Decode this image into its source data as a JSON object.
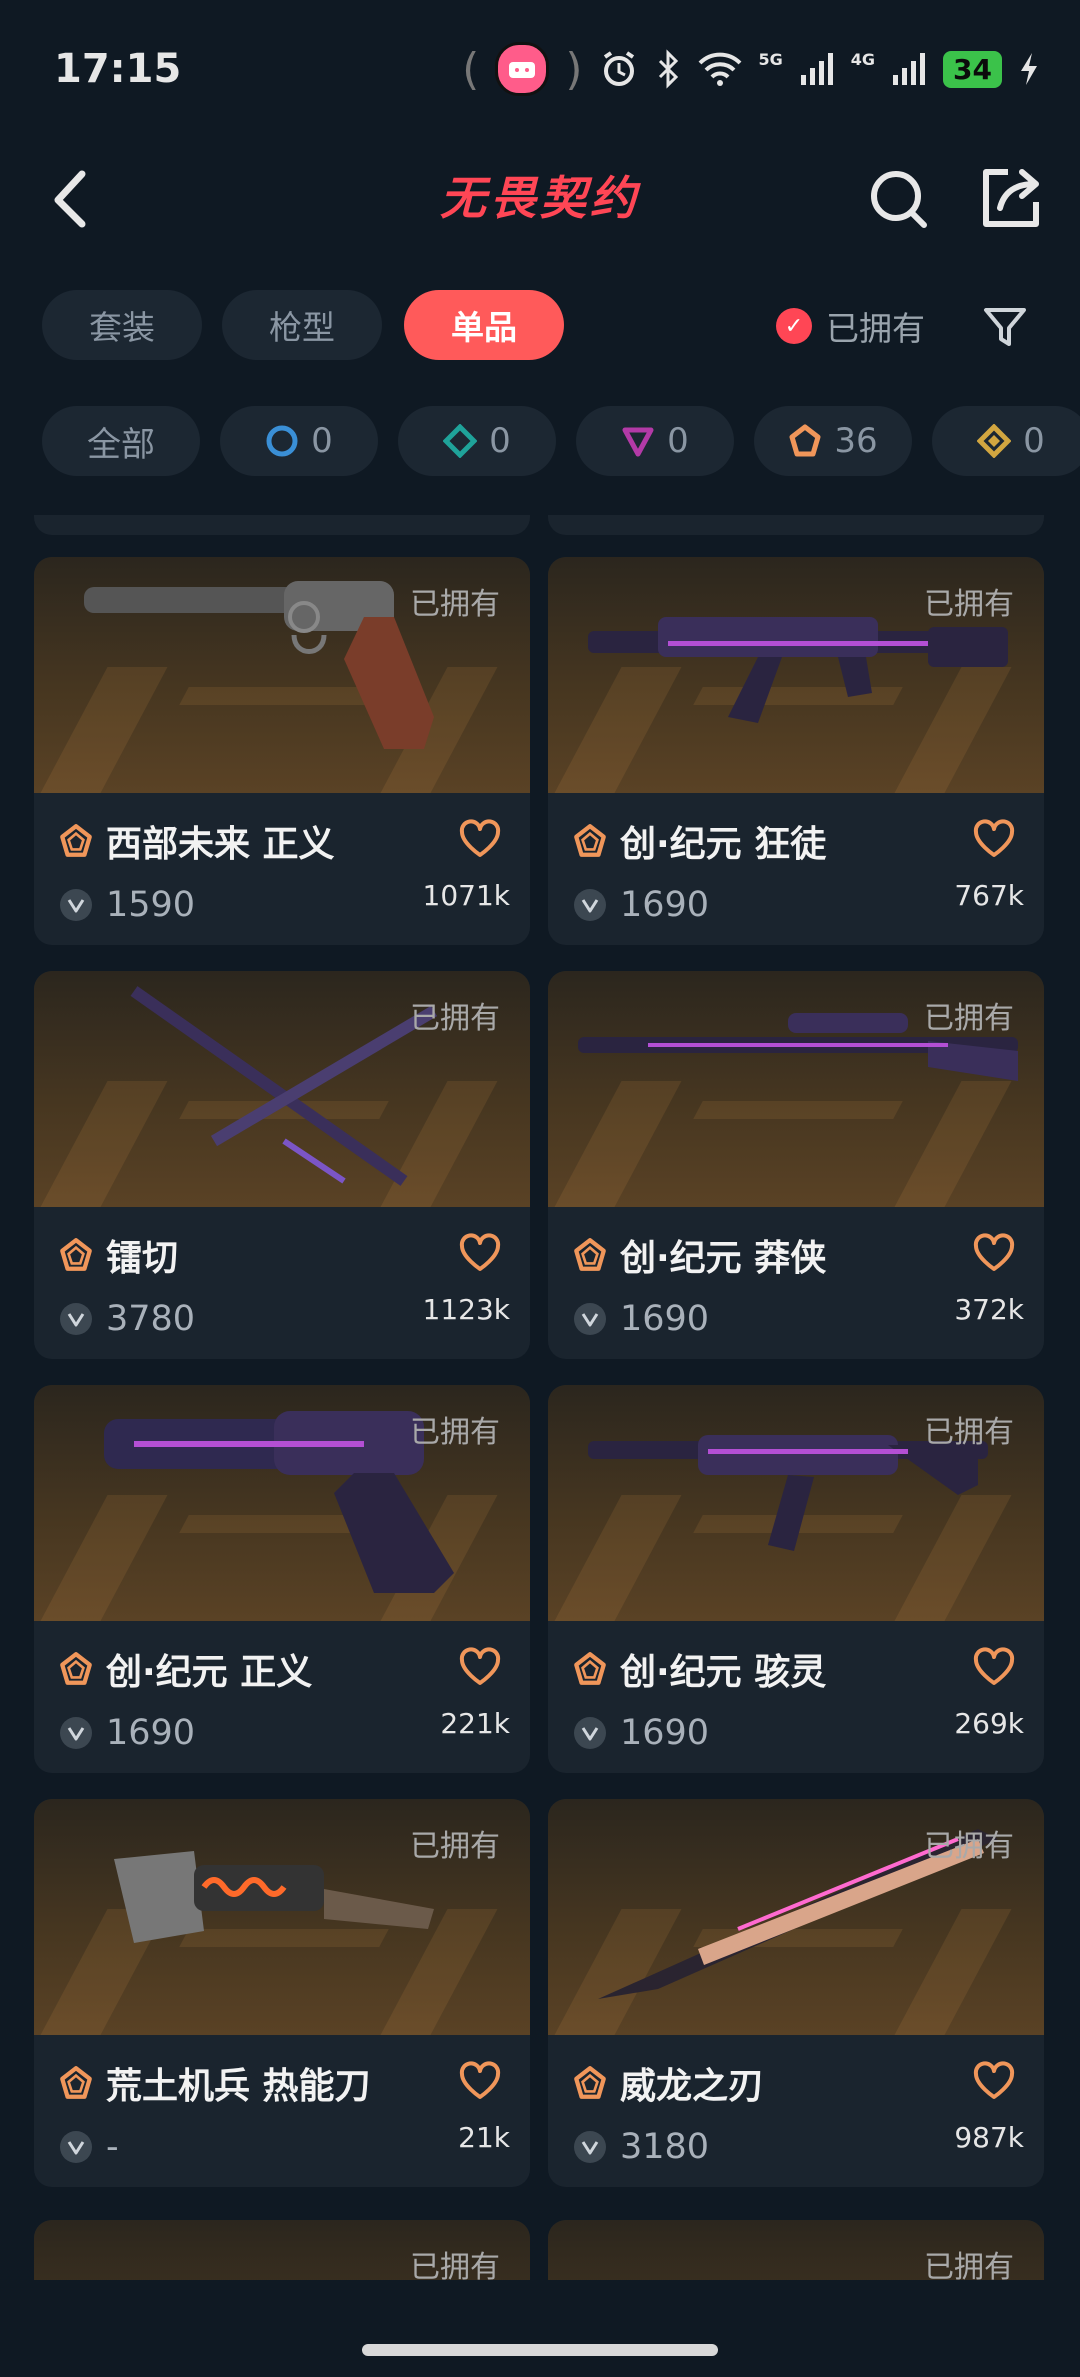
{
  "status_bar": {
    "time": "17:15",
    "battery": "34",
    "net1": "5G",
    "net2": "4G"
  },
  "header": {
    "title": "无畏契约"
  },
  "tabs": [
    {
      "label": "套装",
      "active": false
    },
    {
      "label": "枪型",
      "active": false
    },
    {
      "label": "单品",
      "active": true
    }
  ],
  "owned_filter": {
    "label": "已拥有",
    "checked": true
  },
  "rarity_chips": [
    {
      "label": "全部"
    },
    {
      "count": "0",
      "color": "#3a8fd6",
      "shape": "circle"
    },
    {
      "count": "0",
      "color": "#1fa39a",
      "shape": "diamond"
    },
    {
      "count": "0",
      "color": "#b33aa7",
      "shape": "triangle"
    },
    {
      "count": "36",
      "color": "#f0965a",
      "shape": "pentagon"
    },
    {
      "count": "0",
      "color": "#d2a640",
      "shape": "diamond"
    }
  ],
  "owned_tag": "已拥有",
  "items": [
    {
      "name": "西部未来 正义",
      "price": "1590",
      "likes": "1071k",
      "weapon": "revolver-classic"
    },
    {
      "name": "创·纪元 狂徒",
      "price": "1690",
      "likes": "767k",
      "weapon": "rifle"
    },
    {
      "name": "镭切",
      "price": "3780",
      "likes": "1123k",
      "weapon": "swords"
    },
    {
      "name": "创·纪元 莽侠",
      "price": "1690",
      "likes": "372k",
      "weapon": "sniper"
    },
    {
      "name": "创·纪元 正义",
      "price": "1690",
      "likes": "221k",
      "weapon": "revolver"
    },
    {
      "name": "创·纪元 骇灵",
      "price": "1690",
      "likes": "269k",
      "weapon": "smg"
    },
    {
      "name": "荒土机兵 热能刀",
      "price": "-",
      "likes": "21k",
      "weapon": "heatknife"
    },
    {
      "name": "威龙之刃",
      "price": "3180",
      "likes": "987k",
      "weapon": "blade"
    }
  ]
}
